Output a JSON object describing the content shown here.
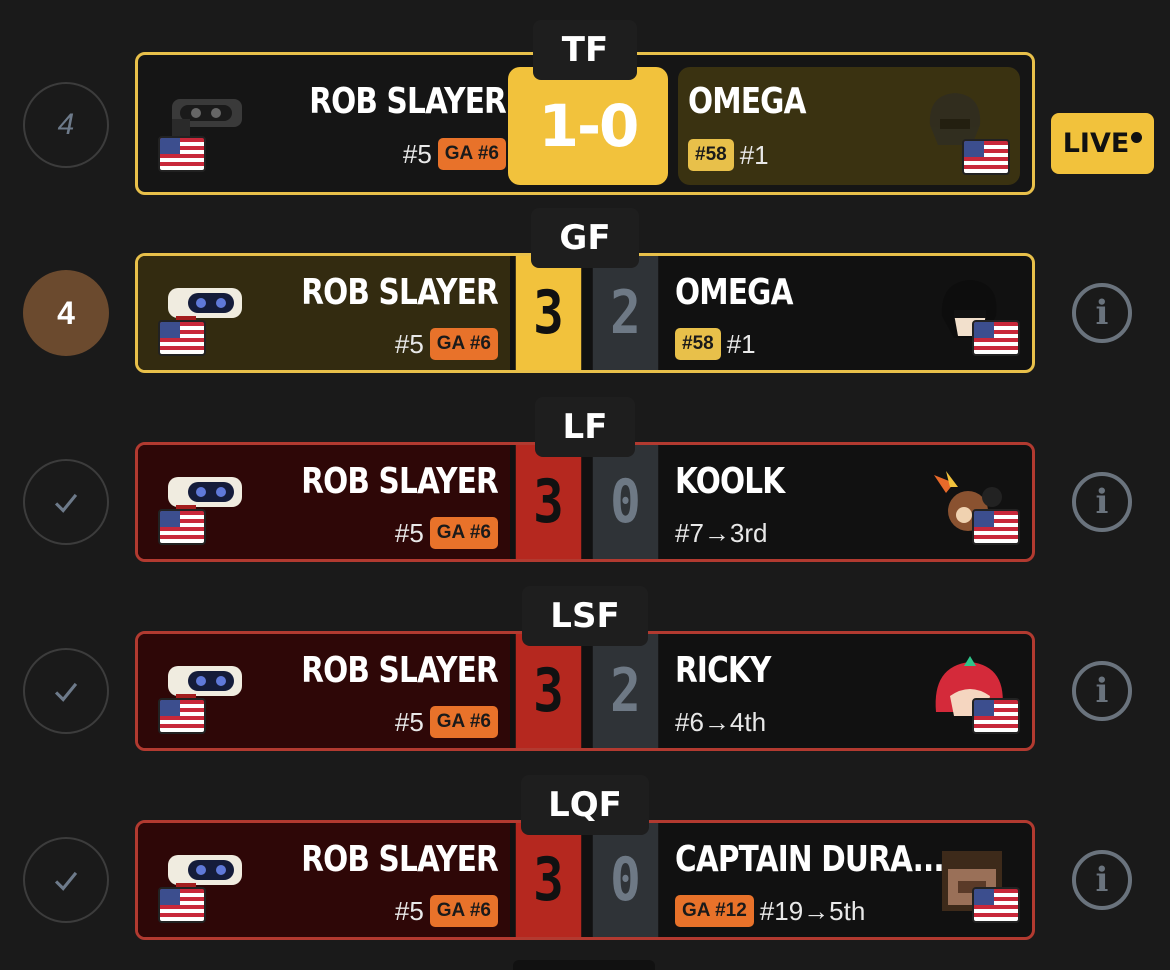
{
  "matches": [
    {
      "round": "TF",
      "status": "4",
      "live_label": "LIVE",
      "player1": {
        "name": "ROB SLAYER",
        "seed": "#5",
        "badge": "GA #6"
      },
      "score": "1-0",
      "player2": {
        "name": "OMEGA",
        "badge": "#58",
        "seed": "#1"
      }
    },
    {
      "round": "GF",
      "status": "4",
      "player1": {
        "name": "ROB SLAYER",
        "seed": "#5",
        "badge": "GA #6",
        "score": "3"
      },
      "player2": {
        "name": "OMEGA",
        "badge": "#58",
        "seed": "#1",
        "score": "2"
      }
    },
    {
      "round": "LF",
      "player1": {
        "name": "ROB SLAYER",
        "seed": "#5",
        "badge": "GA #6",
        "score": "3"
      },
      "player2": {
        "name": "KOOLK",
        "seed": "#7→3rd",
        "score": "0"
      }
    },
    {
      "round": "LSF",
      "player1": {
        "name": "ROB SLAYER",
        "seed": "#5",
        "badge": "GA #6",
        "score": "3"
      },
      "player2": {
        "name": "RICKY",
        "seed": "#6→4th",
        "score": "2"
      }
    },
    {
      "round": "LQF",
      "player1": {
        "name": "ROB SLAYER",
        "seed": "#5",
        "badge": "GA #6",
        "score": "3"
      },
      "player2": {
        "name": "CAPTAIN DURA...",
        "badge": "GA #12",
        "seed": "#19→5th",
        "score": "0"
      }
    }
  ],
  "icons": {
    "status_done": "check-icon",
    "info": "info-icon",
    "flag": "us-flag-icon"
  },
  "colors": {
    "gold": "#f2c23c",
    "win_red": "#b5281f",
    "lose_grey": "#2f3337",
    "badge_orange": "#e8722a"
  }
}
